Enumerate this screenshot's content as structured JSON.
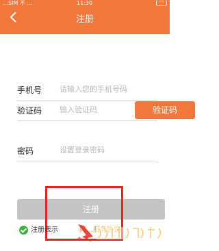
{
  "status_bar": {
    "carrier": "…SIM 不 …",
    "time": "11:30"
  },
  "header": {
    "title": "注册"
  },
  "form": {
    "phone": {
      "label": "手机号",
      "placeholder": "请输入您的手机号码"
    },
    "code": {
      "label": "验证码",
      "placeholder": "输入验证码",
      "button": "验证码"
    },
    "password": {
      "label": "密码",
      "placeholder": "设置登录密码"
    }
  },
  "submit_label": "注册",
  "agreement": {
    "text": "注册表示",
    "link": "同…服务协议"
  },
  "watermark": "系统之家",
  "colors": {
    "accent": "#f0783c",
    "submit_disabled": "#c4c4c4",
    "check": "#3cae3e",
    "highlight": "#e5261f"
  }
}
